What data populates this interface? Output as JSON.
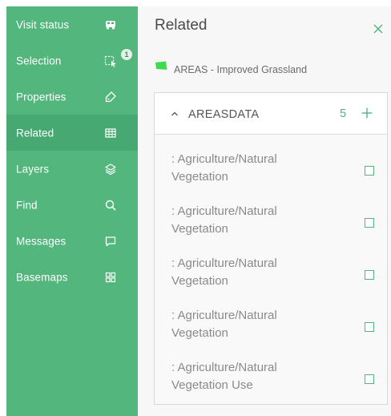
{
  "sidebar": {
    "items": [
      {
        "label": "Visit status",
        "icon": "bus-icon"
      },
      {
        "label": "Selection",
        "icon": "selection-icon",
        "badge": "1"
      },
      {
        "label": "Properties",
        "icon": "tag-icon"
      },
      {
        "label": "Related",
        "icon": "table-icon"
      },
      {
        "label": "Layers",
        "icon": "layers-icon"
      },
      {
        "label": "Find",
        "icon": "search-icon"
      },
      {
        "label": "Messages",
        "icon": "message-icon"
      },
      {
        "label": "Basemaps",
        "icon": "grid-icon"
      }
    ],
    "active_item": "Related"
  },
  "panel": {
    "title": "Related",
    "feature_label": "AREAS - Improved Grassland",
    "related_table": {
      "name": "AREASDATA",
      "count": "5",
      "records": [
        {
          "line1": ": Agriculture/Natural",
          "line2": "Vegetation"
        },
        {
          "line1": ": Agriculture/Natural",
          "line2": "Vegetation"
        },
        {
          "line1": ": Agriculture/Natural",
          "line2": "Vegetation"
        },
        {
          "line1": ": Agriculture/Natural",
          "line2": "Vegetation"
        },
        {
          "line1": ": Agriculture/Natural",
          "line2": "Vegetation Use"
        }
      ]
    }
  },
  "colors": {
    "sidebar": "#52b67d",
    "sidebar_active": "#47a872",
    "accent": "#52b67d",
    "feature_swatch": "#3ddc4e"
  }
}
